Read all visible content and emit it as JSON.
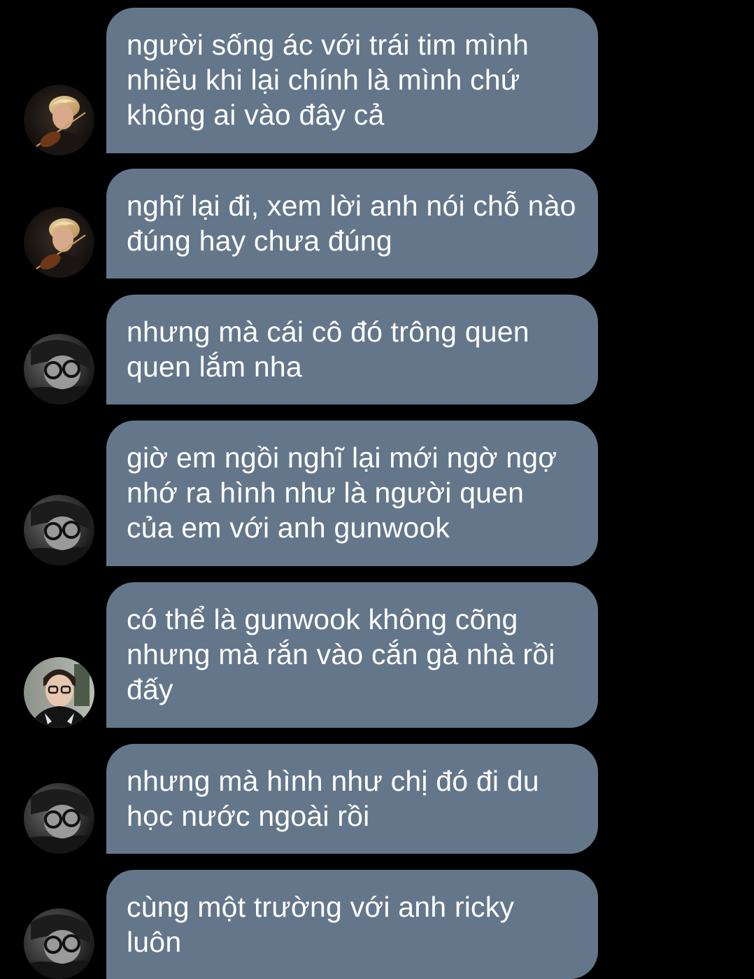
{
  "messages": [
    {
      "avatar": "violinist-avatar",
      "text": "người sống ác với trái tim mình nhiều khi lại chính là mình chứ không ai vào đây cả"
    },
    {
      "avatar": "violinist-avatar",
      "text": "nghĩ lại đi, xem lời anh nói chỗ nào đúng hay chưa đúng"
    },
    {
      "avatar": "glasses-bw-avatar",
      "text": "nhưng mà cái cô đó trông quen quen lắm nha"
    },
    {
      "avatar": "glasses-bw-avatar",
      "text": "giờ em ngồi nghĩ lại mới ngờ ngợ nhớ ra hình như là người quen của em với anh gunwook"
    },
    {
      "avatar": "selfie-avatar",
      "text": "có thể là gunwook không cõng nhưng mà rắn vào cắn gà nhà rồi đấy"
    },
    {
      "avatar": "glasses-bw-avatar",
      "text": "nhưng mà hình như chị đó đi du học nước ngoài rồi"
    },
    {
      "avatar": "glasses-bw-avatar",
      "text": "cùng một trường với anh ricky luôn"
    }
  ],
  "colors": {
    "background": "#000000",
    "bubble": "#64768a",
    "text": "#ffffff"
  }
}
